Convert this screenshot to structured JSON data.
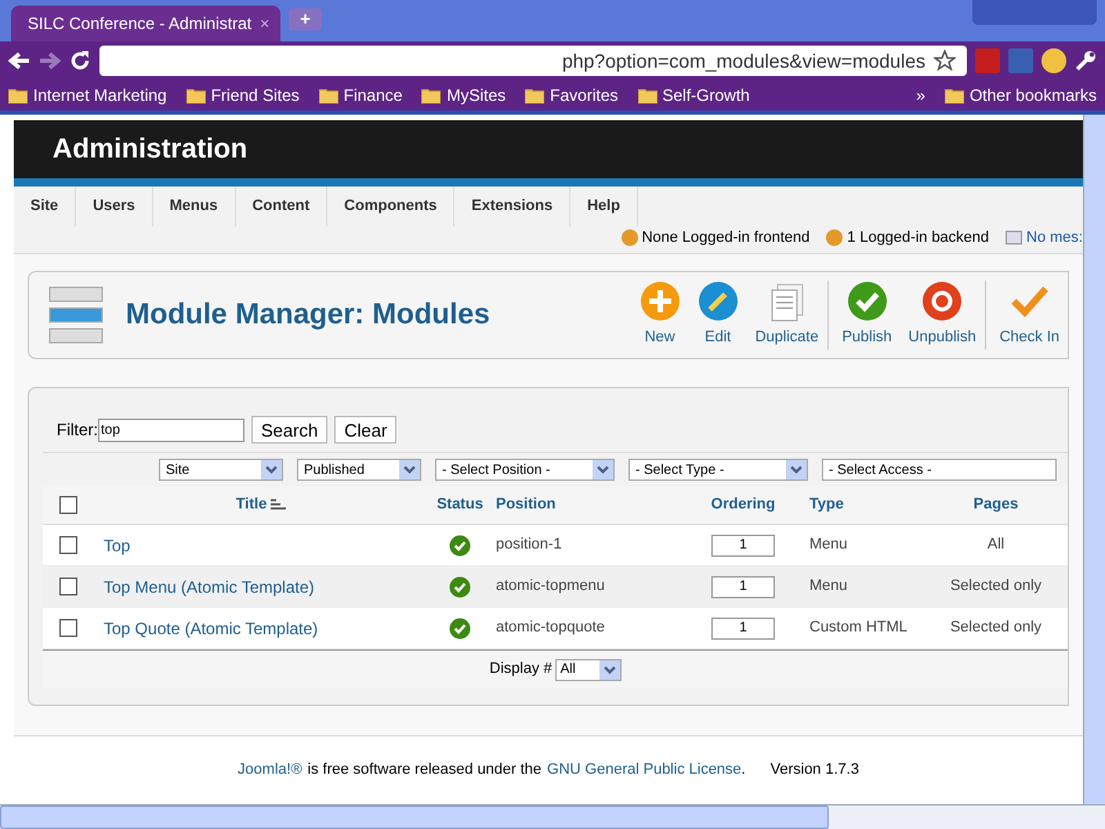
{
  "browser": {
    "tab_title": "SILC Conference - Administrat",
    "tab_close": "×",
    "new_tab": "+",
    "address": "php?option=com_modules&view=modules",
    "bookmarks": [
      "Internet Marketing",
      "Friend Sites",
      "Finance",
      "MySites",
      "Favorites",
      "Self-Growth"
    ],
    "more": "»",
    "other_bookmarks": "Other bookmarks"
  },
  "header": {
    "title": "Administration"
  },
  "menu": [
    "Site",
    "Users",
    "Menus",
    "Content",
    "Components",
    "Extensions",
    "Help"
  ],
  "status": {
    "frontend": "None Logged-in frontend",
    "backend": "1 Logged-in backend",
    "messages": "No mes:"
  },
  "toolbar": {
    "title": "Module Manager: Modules",
    "buttons": [
      {
        "label": "New",
        "kind": "new"
      },
      {
        "label": "Edit",
        "kind": "edit"
      },
      {
        "label": "Duplicate",
        "kind": "duplicate"
      },
      {
        "label": "Publish",
        "kind": "publish"
      },
      {
        "label": "Unpublish",
        "kind": "unpublish"
      },
      {
        "label": "Check In",
        "kind": "checkin"
      }
    ]
  },
  "filter": {
    "label": "Filter:",
    "value": "top",
    "search": "Search",
    "clear": "Clear",
    "selects": [
      "Site",
      "Published",
      "- Select Position -",
      "- Select Type -",
      "- Select Access -"
    ]
  },
  "table": {
    "select_all_checked": false,
    "columns": [
      "Title",
      "Status",
      "Position",
      "Ordering",
      "Type",
      "Pages"
    ],
    "rows": [
      {
        "title": "Top",
        "checked": false,
        "published": true,
        "position": "position-1",
        "ordering": "1",
        "type": "Menu",
        "pages": "All"
      },
      {
        "title": "Top Menu (Atomic Template)",
        "checked": false,
        "published": true,
        "position": "atomic-topmenu",
        "ordering": "1",
        "type": "Menu",
        "pages": "Selected only"
      },
      {
        "title": "Top Quote (Atomic Template)",
        "checked": false,
        "published": true,
        "position": "atomic-topquote",
        "ordering": "1",
        "type": "Custom HTML",
        "pages": "Selected only"
      }
    ],
    "display_label": "Display #",
    "display_value": "All"
  },
  "footer": {
    "joomla": "Joomla!®",
    "text": "is free software released under the",
    "license": "GNU General Public License",
    "period": ".",
    "version": "Version 1.7.3"
  }
}
